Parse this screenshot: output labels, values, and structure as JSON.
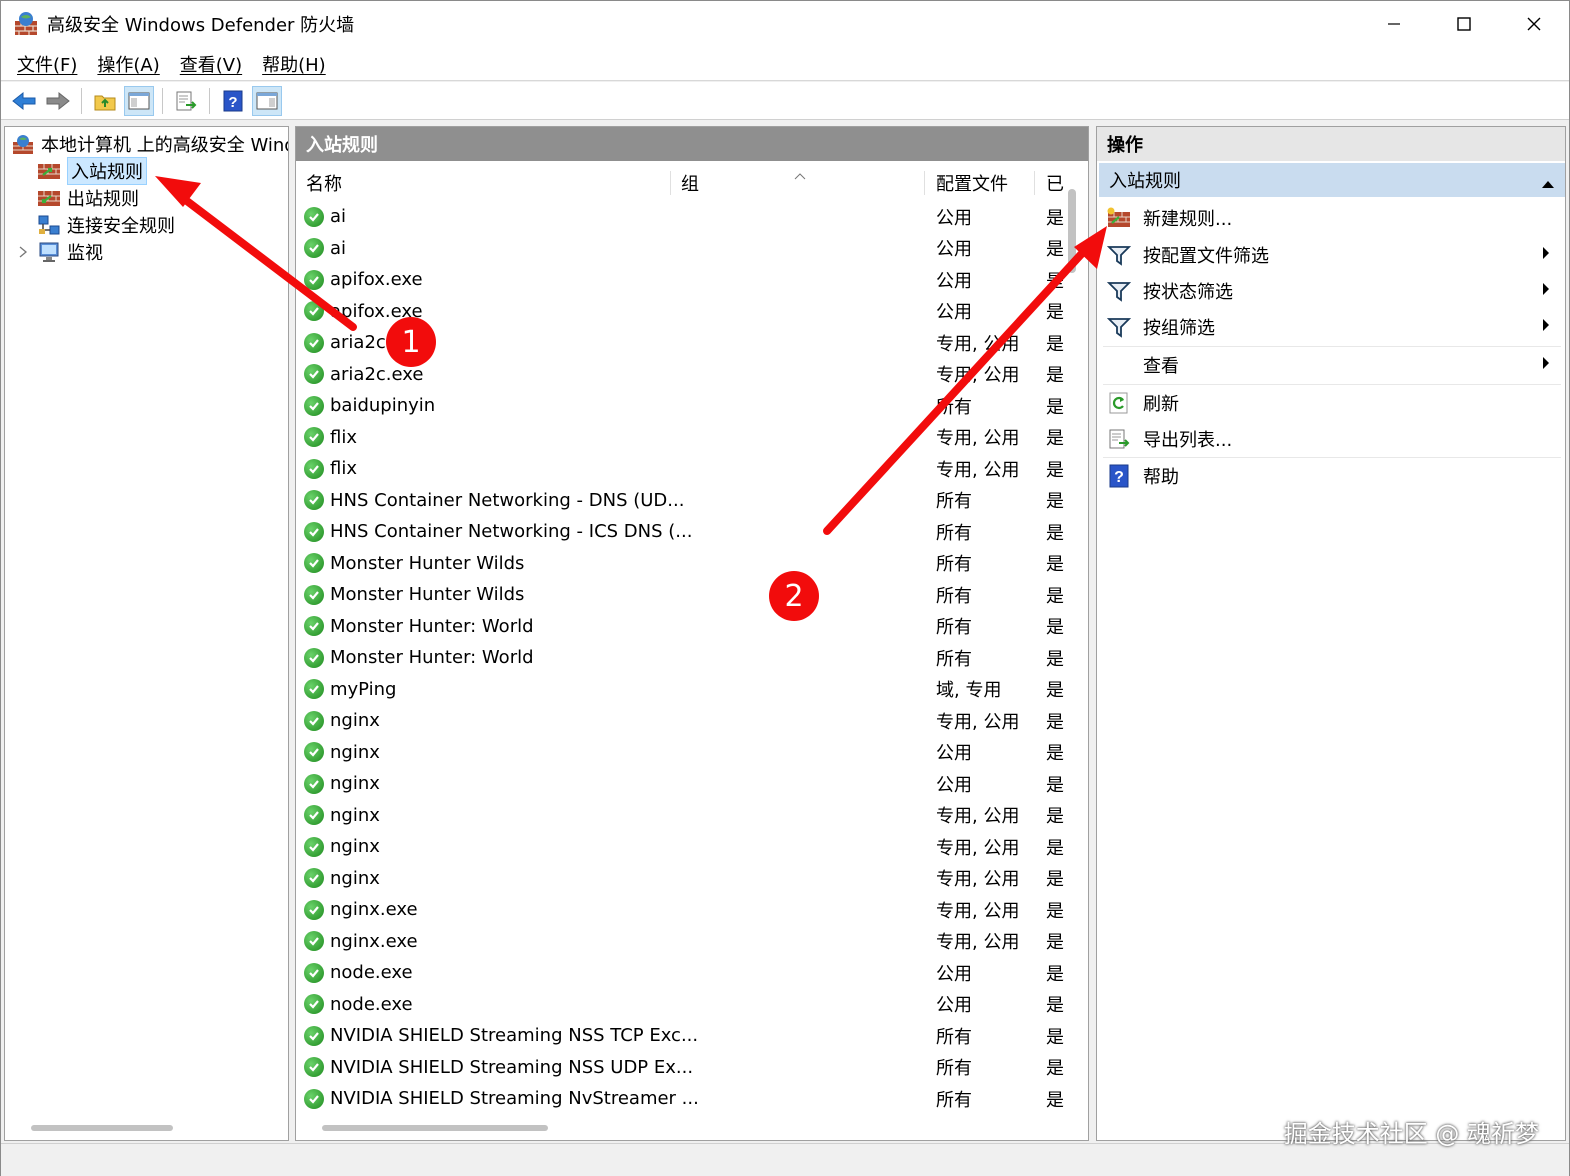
{
  "window": {
    "title": "高级安全 Windows Defender 防火墙",
    "controls": [
      "minimize-icon",
      "maximize-icon",
      "close-icon"
    ]
  },
  "menu": [
    "文件(F)",
    "操作(A)",
    "查看(V)",
    "帮助(H)"
  ],
  "toolbar": {
    "buttons": [
      "back-arrow-icon",
      "forward-arrow-icon",
      "up-folder-icon",
      "show-hide-console-tree-icon",
      "export-list-icon",
      "help-icon",
      "show-hide-action-pane-icon"
    ]
  },
  "tree": {
    "root": "本地计算机 上的高级安全 Windows Defender 防火墙",
    "items": [
      {
        "label": "入站规则",
        "icon": "inbound-rules-icon",
        "selected": true
      },
      {
        "label": "出站规则",
        "icon": "outbound-rules-icon",
        "selected": false
      },
      {
        "label": "连接安全规则",
        "icon": "connection-security-icon",
        "selected": false
      },
      {
        "label": "监视",
        "icon": "monitor-icon",
        "selected": false
      }
    ]
  },
  "list": {
    "title": "入站规则",
    "columns": [
      "名称",
      "组",
      "配置文件",
      "已"
    ],
    "rows": [
      [
        "ai",
        "",
        "公用",
        "是"
      ],
      [
        "ai",
        "",
        "公用",
        "是"
      ],
      [
        "apifox.exe",
        "",
        "公用",
        "是"
      ],
      [
        "apifox.exe",
        "",
        "公用",
        "是"
      ],
      [
        "aria2c.exe",
        "",
        "专用, 公用",
        "是"
      ],
      [
        "aria2c.exe",
        "",
        "专用, 公用",
        "是"
      ],
      [
        "baidupinyin",
        "",
        "所有",
        "是"
      ],
      [
        "flix",
        "",
        "专用, 公用",
        "是"
      ],
      [
        "flix",
        "",
        "专用, 公用",
        "是"
      ],
      [
        "HNS Container Networking - DNS (UD...",
        "",
        "所有",
        "是"
      ],
      [
        "HNS Container Networking - ICS DNS (...",
        "",
        "所有",
        "是"
      ],
      [
        "Monster Hunter Wilds",
        "",
        "所有",
        "是"
      ],
      [
        "Monster Hunter Wilds",
        "",
        "所有",
        "是"
      ],
      [
        "Monster Hunter: World",
        "",
        "所有",
        "是"
      ],
      [
        "Monster Hunter: World",
        "",
        "所有",
        "是"
      ],
      [
        "myPing",
        "",
        "域, 专用",
        "是"
      ],
      [
        "nginx",
        "",
        "专用, 公用",
        "是"
      ],
      [
        "nginx",
        "",
        "公用",
        "是"
      ],
      [
        "nginx",
        "",
        "公用",
        "是"
      ],
      [
        "nginx",
        "",
        "专用, 公用",
        "是"
      ],
      [
        "nginx",
        "",
        "专用, 公用",
        "是"
      ],
      [
        "nginx",
        "",
        "专用, 公用",
        "是"
      ],
      [
        "nginx.exe",
        "",
        "专用, 公用",
        "是"
      ],
      [
        "nginx.exe",
        "",
        "专用, 公用",
        "是"
      ],
      [
        "node.exe",
        "",
        "公用",
        "是"
      ],
      [
        "node.exe",
        "",
        "公用",
        "是"
      ],
      [
        "NVIDIA SHIELD Streaming NSS TCP Exc...",
        "",
        "所有",
        "是"
      ],
      [
        "NVIDIA SHIELD Streaming NSS UDP Ex...",
        "",
        "所有",
        "是"
      ],
      [
        "NVIDIA SHIELD Streaming NvStreamer ...",
        "",
        "所有",
        "是"
      ]
    ]
  },
  "actions": {
    "title": "操作",
    "section": "入站规则",
    "items": [
      {
        "label": "新建规则...",
        "icon": "new-rule-icon",
        "submenu": false
      },
      {
        "label": "按配置文件筛选",
        "icon": "filter-icon",
        "submenu": true
      },
      {
        "label": "按状态筛选",
        "icon": "filter-icon",
        "submenu": true
      },
      {
        "label": "按组筛选",
        "icon": "filter-icon",
        "submenu": true
      },
      {
        "label": "查看",
        "icon": "",
        "submenu": true
      },
      {
        "label": "刷新",
        "icon": "refresh-icon",
        "submenu": false
      },
      {
        "label": "导出列表...",
        "icon": "export-list-icon",
        "submenu": false
      },
      {
        "label": "帮助",
        "icon": "help-icon",
        "submenu": false
      }
    ]
  },
  "annotations": {
    "badge1": "1",
    "badge2": "2",
    "arrow_color": "#f20c0c"
  },
  "watermark": "掘金技术社区 @ 魂祈梦"
}
